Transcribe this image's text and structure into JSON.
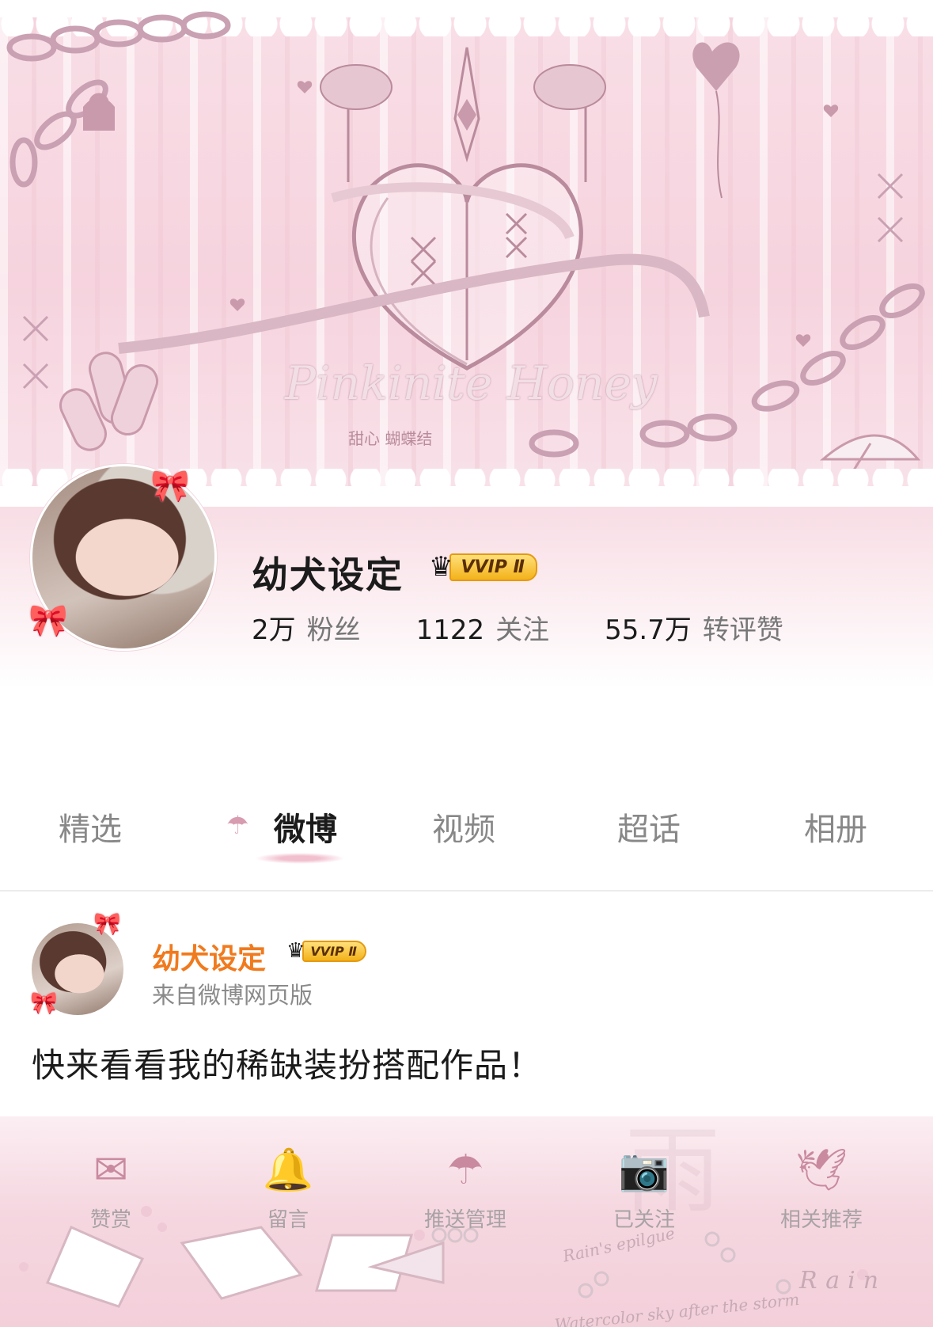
{
  "theme": {
    "accent": "#f07a1e",
    "vip_gold": "#f3b21a",
    "pink": "#f6d3de"
  },
  "profile": {
    "name": "幼犬设定",
    "vip_label": "VVIP Ⅱ",
    "stats": [
      {
        "value": "2万",
        "label": "粉丝"
      },
      {
        "value": "1122",
        "label": "关注"
      },
      {
        "value": "55.7万",
        "label": "转评赞"
      }
    ]
  },
  "banner": {
    "subtitle": "甜心 蝴蝶结",
    "script_text": "Pinkinite Honey"
  },
  "tabs": [
    {
      "label": "精选"
    },
    {
      "label": "微博"
    },
    {
      "label": "视频"
    },
    {
      "label": "超话"
    },
    {
      "label": "相册"
    }
  ],
  "post": {
    "author": "幼犬设定",
    "vip_label": "VVIP Ⅱ",
    "source": "来自微博网页版",
    "text": "快来看看我的稀缺装扮搭配作品！"
  },
  "actions": [
    {
      "label": "赞赏",
      "icon": "envelope-pen-icon"
    },
    {
      "label": "留言",
      "icon": "bell-bow-icon"
    },
    {
      "label": "推送管理",
      "icon": "umbrella-icon"
    },
    {
      "label": "已关注",
      "icon": "camera-icon"
    },
    {
      "label": "相关推荐",
      "icon": "paper-crane-icon"
    }
  ],
  "decor": {
    "rain_text": "Rain's epilgue",
    "watercolor_text": "Watercolor sky after the storm",
    "rain_word": "Rain"
  }
}
